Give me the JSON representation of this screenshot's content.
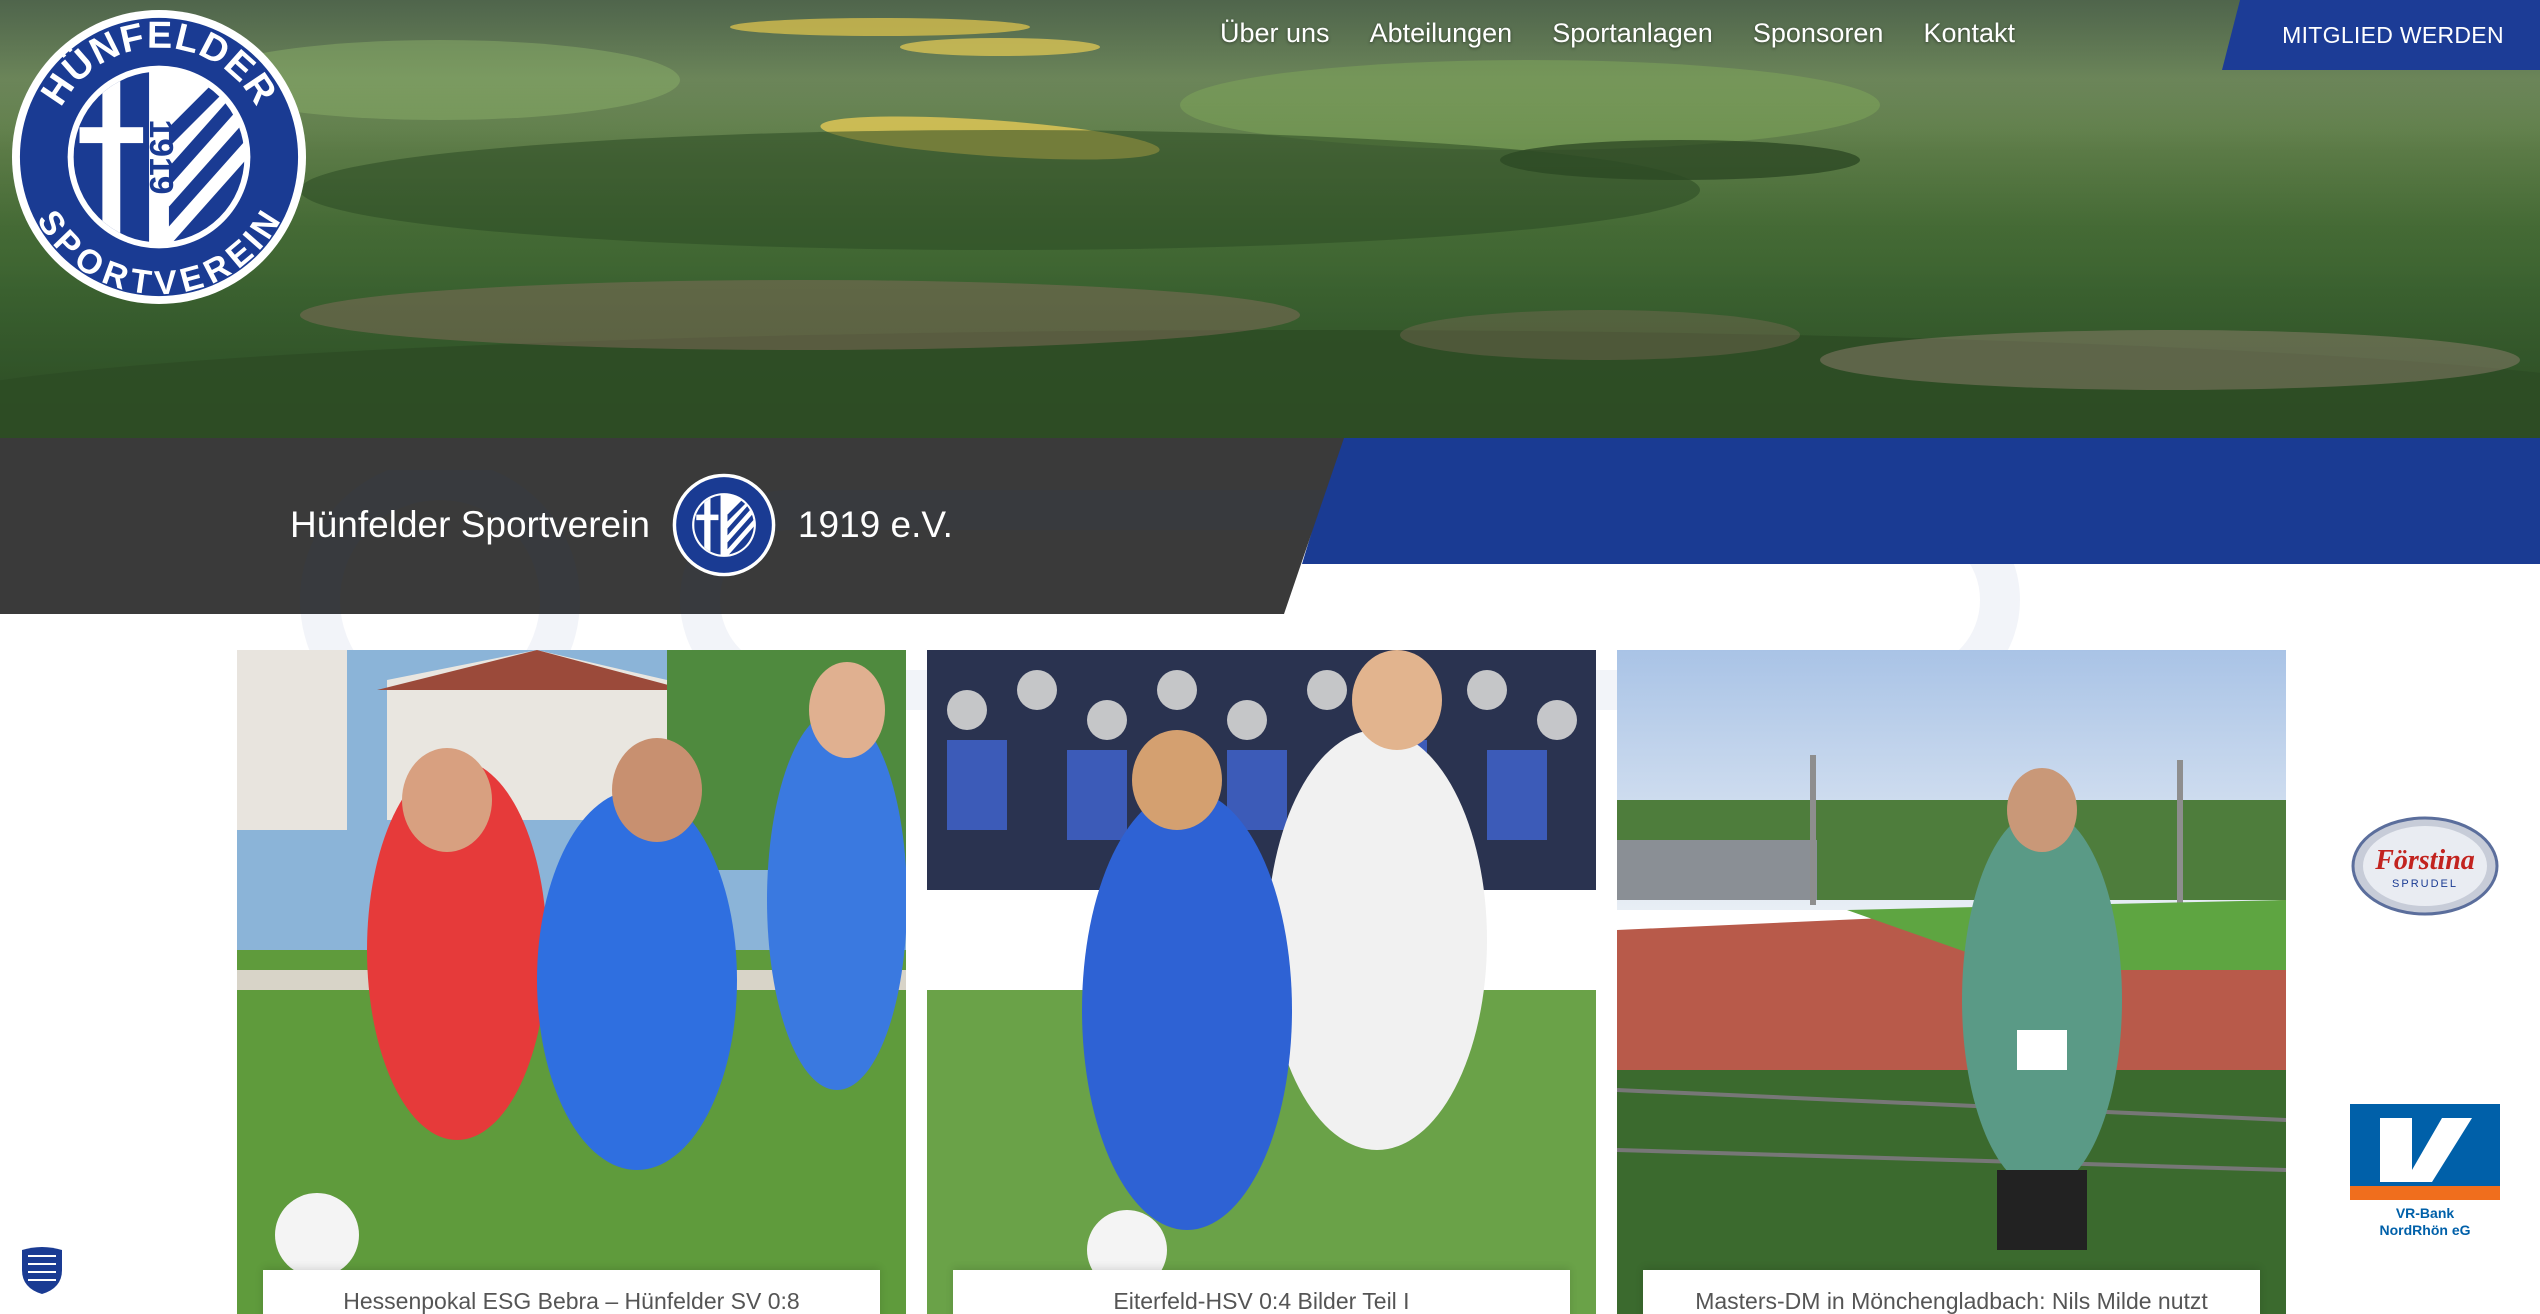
{
  "nav": {
    "items": [
      {
        "label": "Über uns"
      },
      {
        "label": "Abteilungen"
      },
      {
        "label": "Sportanlagen"
      },
      {
        "label": "Sponsoren"
      },
      {
        "label": "Kontakt"
      }
    ],
    "cta_label": "MITGLIED WERDEN"
  },
  "logo": {
    "text_top": "HÜNFELDER",
    "text_bottom": "SPORTVEREIN",
    "year": "1919",
    "ev": "EV"
  },
  "banner": {
    "title_left": "Hünfelder Sportverein",
    "title_right": "1919 e.V."
  },
  "cards": [
    {
      "caption": "Hessenpokal ESG Bebra – Hünfelder SV 0:8"
    },
    {
      "caption": "Eiterfeld-HSV 0:4 Bilder Teil I"
    },
    {
      "caption": "Masters-DM in Mönchengladbach: Nils Milde nutzt"
    }
  ],
  "sponsors": {
    "forstina": {
      "name": "Förstina",
      "sub": "SPRUDEL"
    },
    "vrbank": {
      "line1": "VR-Bank",
      "line2": "NordRhön eG"
    }
  },
  "colors": {
    "club_blue": "#1a3b93",
    "banner_dark": "#3a3a3a",
    "cta_blue": "#1c3c96"
  },
  "icons": {
    "small_badge": "shield-icon"
  }
}
